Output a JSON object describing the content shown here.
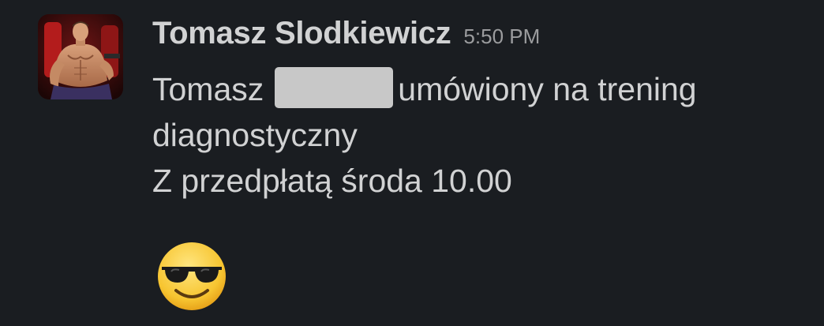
{
  "message": {
    "sender_name": "Tomasz Slodkiewicz",
    "timestamp": "5:50 PM",
    "lines": {
      "line1_before": "Tomasz",
      "line1_after": "umówiony na trening",
      "line2": "diagnostyczny",
      "line3": "Z przedpłatą środa 10.00"
    },
    "emoji": "smiling-face-with-sunglasses"
  },
  "colors": {
    "background": "#1a1d21",
    "text": "#d1d2d3",
    "timestamp": "#9b9c9e",
    "redaction": "#c8c8c8"
  }
}
